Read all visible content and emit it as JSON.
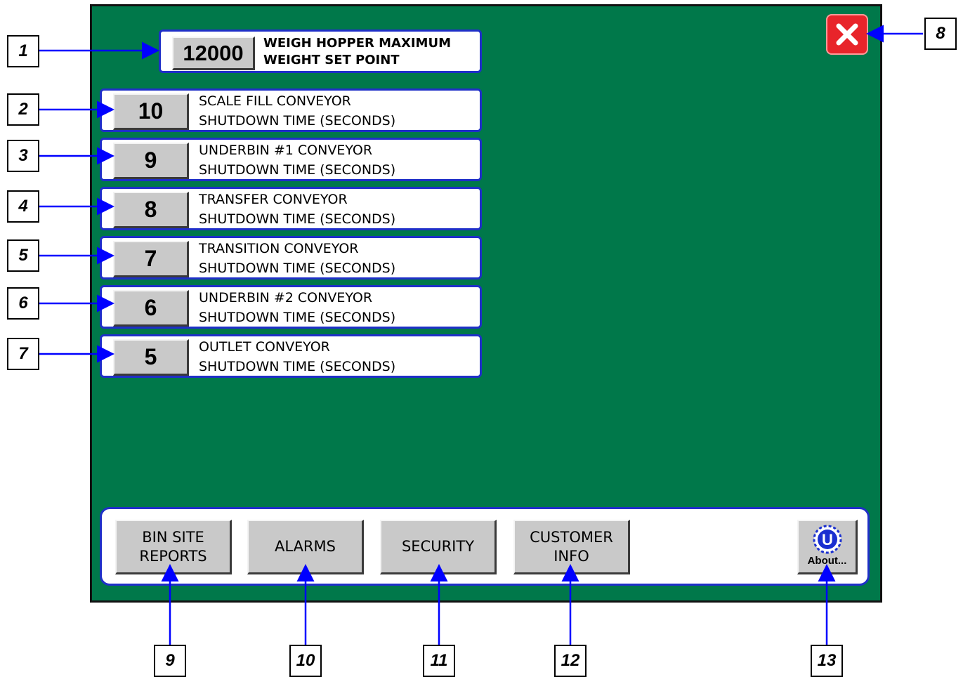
{
  "main": {
    "setpoint": {
      "value": "12000",
      "label_line1": "WEIGH HOPPER MAXIMUM",
      "label_line2": "WEIGHT SET POINT"
    },
    "rows": [
      {
        "value": "10",
        "line1": "SCALE FILL CONVEYOR",
        "line2": "SHUTDOWN TIME (SECONDS)"
      },
      {
        "value": "9",
        "line1": "UNDERBIN #1 CONVEYOR",
        "line2": "SHUTDOWN TIME (SECONDS)"
      },
      {
        "value": "8",
        "line1": "TRANSFER CONVEYOR",
        "line2": "SHUTDOWN TIME (SECONDS)"
      },
      {
        "value": "7",
        "line1": "TRANSITION CONVEYOR",
        "line2": "SHUTDOWN TIME (SECONDS)"
      },
      {
        "value": "6",
        "line1": "UNDERBIN #2 CONVEYOR",
        "line2": "SHUTDOWN TIME (SECONDS)"
      },
      {
        "value": "5",
        "line1": "OUTLET CONVEYOR",
        "line2": "SHUTDOWN TIME (SECONDS)"
      }
    ]
  },
  "nav": {
    "bin_site_reports": "BIN SITE\nREPORTS",
    "alarms": "ALARMS",
    "security": "SECURITY",
    "customer_info": "CUSTOMER\nINFO",
    "about": "About..."
  },
  "callouts": [
    "1",
    "2",
    "3",
    "4",
    "5",
    "6",
    "7",
    "8",
    "9",
    "10",
    "11",
    "12",
    "13"
  ],
  "colors": {
    "screen": "#00784a",
    "border": "#1f2fc8",
    "close": "#e8242a",
    "arrow": "#0000ff"
  }
}
